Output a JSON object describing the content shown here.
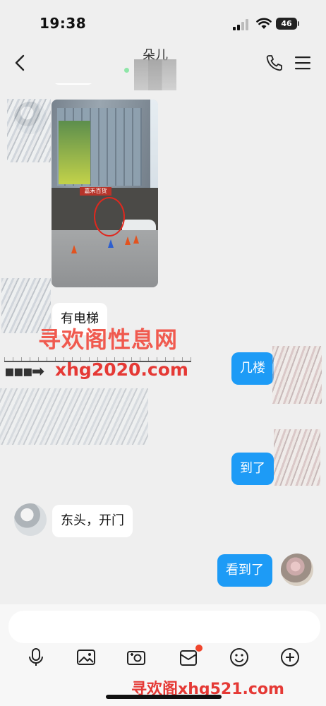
{
  "status_bar": {
    "time": "19:38",
    "battery": "46"
  },
  "header": {
    "contact_name": "朵儿"
  },
  "messages": [
    {
      "side": "in",
      "type": "image"
    },
    {
      "side": "in",
      "text": "有电梯"
    },
    {
      "side": "out",
      "text": "几楼"
    },
    {
      "side": "out",
      "text": "到了"
    },
    {
      "side": "in",
      "text": "东头，开门"
    },
    {
      "side": "out",
      "text": "看到了"
    }
  ],
  "watermarks": {
    "top_cn": "寻欢阁性息网",
    "top_url": "xhg2020.com",
    "bottom": "寻欢阁xhg521.com"
  },
  "photo": {
    "sign_text": "嘉禾百货"
  },
  "input": {
    "placeholder": ""
  },
  "toolbar": [
    "mic-icon",
    "image-icon",
    "camera-icon",
    "gift-icon",
    "emoji-icon",
    "plus-icon"
  ],
  "colors": {
    "accent": "#1d9bf6",
    "badge": "#f0452c",
    "watermark": "#e53935"
  }
}
